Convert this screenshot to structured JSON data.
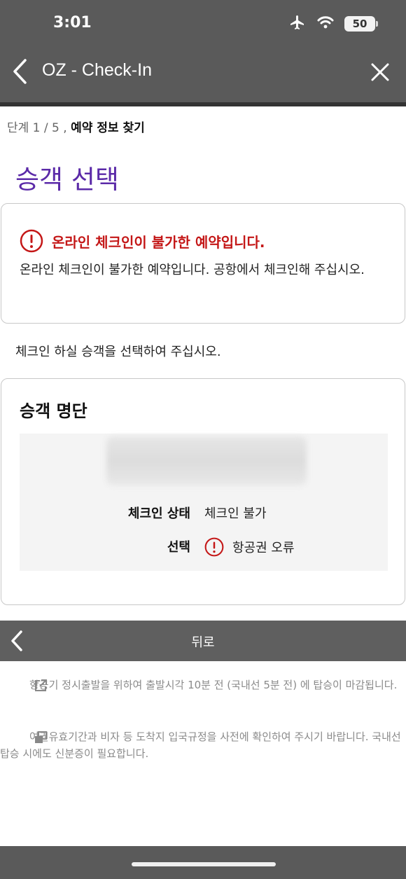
{
  "status_bar": {
    "time": "3:01",
    "battery": "50"
  },
  "nav": {
    "title": "OZ - Check-In"
  },
  "step": {
    "prefix": "단계 1 / 5 ,",
    "name": "예약 정보 찾기"
  },
  "heading": "승객 선택",
  "alert": {
    "title": "온라인 체크인이 불가한 예약입니다.",
    "body": "온라인 체크인이 불가한 예약입니다. 공항에서 체크인해 주십시오.",
    "color": "#c41717"
  },
  "instruction": "체크인 하실 승객을 선택하여 주십시오.",
  "passenger_list": {
    "title": "승객 명단",
    "checkin_status_label": "체크인 상태",
    "checkin_status_value": "체크인 불가",
    "select_label": "선택",
    "select_value": "항공권 오류"
  },
  "back_button": {
    "label": "뒤로"
  },
  "notes": [
    {
      "icon": "external-link-icon",
      "text": "항공기 정시출발을 위하여 출발시각 10분 전 (국내선 5분 전) 에 탑승이 마감됩니다."
    },
    {
      "icon": "copy-window-icon",
      "text": "여권유효기간과 비자 등 도착지 입국규정을 사전에 확인하여 주시기 바랍니다. 국내선 탑승 시에도 신분증이 필요합니다."
    }
  ],
  "colors": {
    "header": "#5a5a5a",
    "accent_purple": "#5b2aa8",
    "error_red": "#c41717"
  }
}
